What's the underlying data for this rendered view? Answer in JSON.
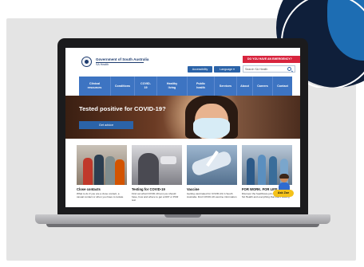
{
  "site": {
    "gov_name": "Government of South Australia",
    "gov_sub": "SA Health",
    "cta_red": "DO YOU HAVE AN EMERGENCY?",
    "accessibility": "Accessibility",
    "language": "Language ▾",
    "search_placeholder": "Search SA Health"
  },
  "nav": {
    "items": [
      {
        "label": "Clinical\nresources"
      },
      {
        "label": "Conditions"
      },
      {
        "label": "COVID-\n19"
      },
      {
        "label": "Healthy\nliving"
      },
      {
        "label": "Public\nhealth"
      },
      {
        "label": "Services"
      },
      {
        "label": "About"
      },
      {
        "label": "Careers"
      },
      {
        "label": "Contact"
      }
    ]
  },
  "hero": {
    "title": "Tested positive for COVID-19?",
    "button": "Get advice"
  },
  "cards": [
    {
      "title": "Close contacts",
      "desc": "What to do if you are a close contact, a casual contact or when you have to isolate"
    },
    {
      "title": "Testing for COVID-19",
      "desc": "Find out what COVID-19 test you should have, how and where to get a RAT or PCR test"
    },
    {
      "title": "Vaccine",
      "desc": "Getting vaccinated for COVID-19 in South Australia. Find COVID-19 vaccine information"
    },
    {
      "title": "FOR WORK. FOR LIFE.",
      "desc": "Discover the healthcare job opportunities at SA Health and everything that that's waiting"
    }
  ],
  "assistant": {
    "label": "Ask Zoe"
  },
  "colors": {
    "primary_blue": "#2b63a8",
    "nav_blue": "#3d74c2",
    "alert_red": "#d8243d",
    "zoe_yellow": "#f4c21a"
  }
}
